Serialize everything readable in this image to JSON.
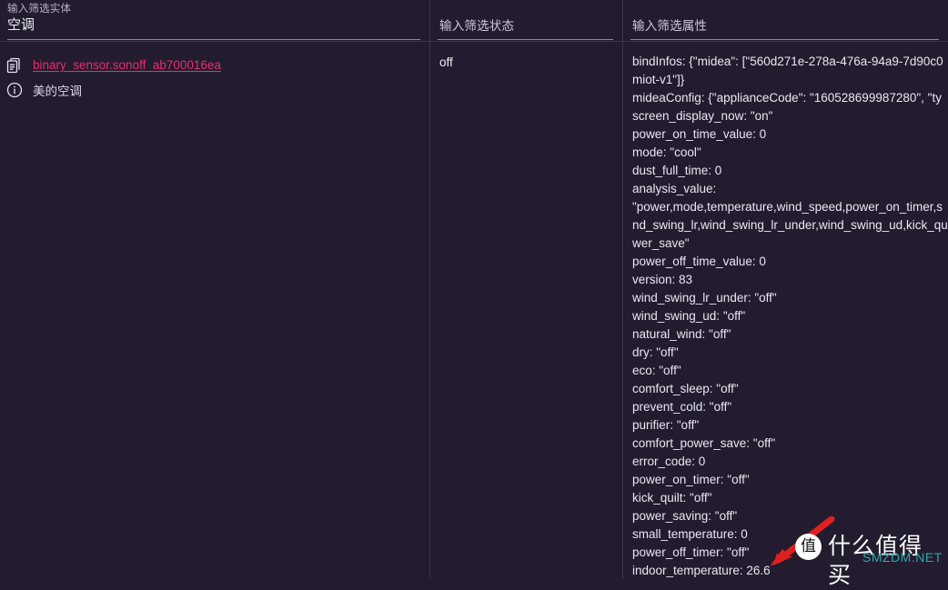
{
  "theme": {
    "background": "#221c2e",
    "divider": "#3b3450",
    "link_color": "#ec2b72",
    "text_color": "#eae7f1",
    "muted_text": "#b8b2c6",
    "watermark_accent": "#2fa8a8",
    "arrow_color": "#e02020"
  },
  "columns": {
    "entity": {
      "header_label": "输入筛选实体",
      "header_value": "空调",
      "rows": [
        {
          "icon": "clipboard-copy-icon",
          "text": "binary_sensor.sonoff_ab700016ea",
          "is_link": true
        },
        {
          "icon": "info-circle-icon",
          "text": "美的空调",
          "is_link": false
        }
      ]
    },
    "state": {
      "header_label": "输入筛选状态",
      "value": "off"
    },
    "attributes": {
      "header_label": "输入筛选属性",
      "lines": [
        "bindInfos: {\"midea\": [\"560d271e-278a-476a-94a9-7d90c0",
        "miot-v1\"]}",
        "mideaConfig: {\"applianceCode\": \"160528699987280\", \"ty",
        "screen_display_now: \"on\"",
        "power_on_time_value: 0",
        "mode: \"cool\"",
        "dust_full_time: 0",
        "analysis_value:",
        "\"power,mode,temperature,wind_speed,power_on_timer,s",
        "nd_swing_lr,wind_swing_lr_under,wind_swing_ud,kick_qu",
        "wer_save\"",
        "power_off_time_value: 0",
        "version: 83",
        "wind_swing_lr_under: \"off\"",
        "wind_swing_ud: \"off\"",
        "natural_wind: \"off\"",
        "dry: \"off\"",
        "eco: \"off\"",
        "comfort_sleep: \"off\"",
        "prevent_cold: \"off\"",
        "purifier: \"off\"",
        "comfort_power_save: \"off\"",
        "error_code: 0",
        "power_on_timer: \"off\"",
        "kick_quilt: \"off\"",
        "power_saving: \"off\"",
        "small_temperature: 0",
        "power_off_timer: \"off\"",
        "indoor_temperature: 26.6"
      ]
    }
  },
  "watermark": {
    "badge_char": "值",
    "title": "什么值得买",
    "site": "SMZDM.NET"
  }
}
